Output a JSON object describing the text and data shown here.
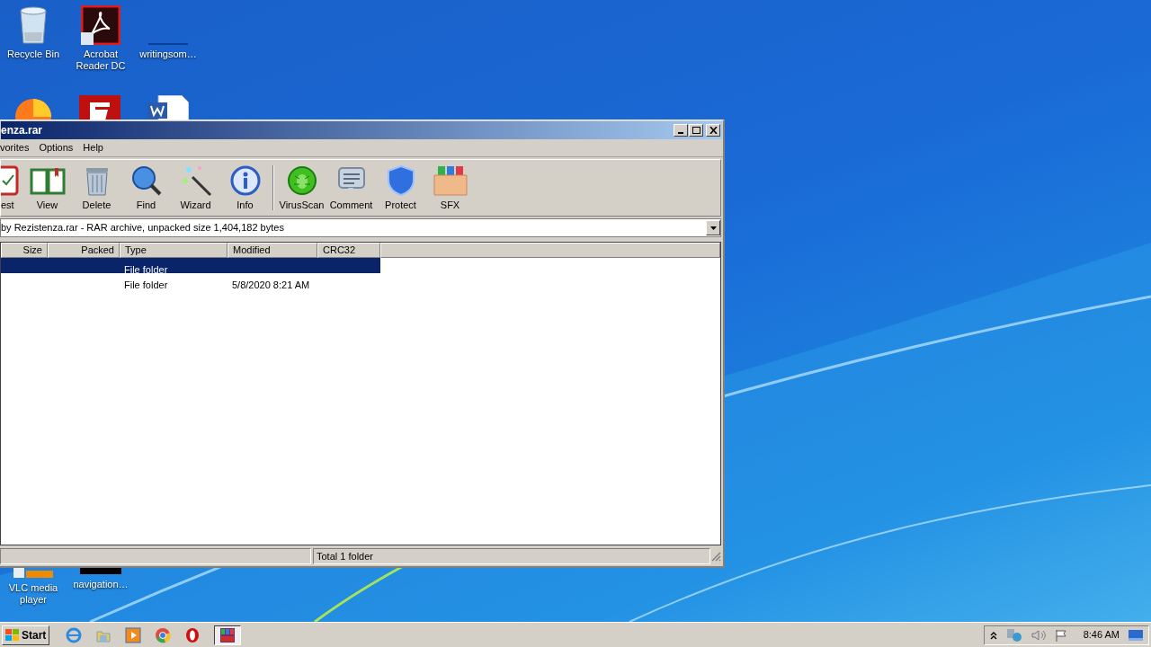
{
  "desktop_icons": [
    {
      "label": "Recycle Bin",
      "kind": "recycle"
    },
    {
      "label": "Acrobat Reader DC",
      "kind": "acrobat"
    },
    {
      "label": "writingsom…",
      "kind": "blank"
    }
  ],
  "bottom_icons": [
    {
      "label": "VLC media player",
      "kind": "vlc"
    },
    {
      "label": "navigation…",
      "kind": "dark"
    }
  ],
  "window": {
    "title": "enza.rar",
    "menu": [
      "vorites",
      "Options",
      "Help"
    ],
    "toolbar": [
      {
        "label": "est",
        "kind": "test"
      },
      {
        "label": "View",
        "kind": "view"
      },
      {
        "label": "Delete",
        "kind": "delete"
      },
      {
        "label": "Find",
        "kind": "find"
      },
      {
        "label": "Wizard",
        "kind": "wizard"
      },
      {
        "label": "Info",
        "kind": "info"
      },
      {
        "label": "VirusScan",
        "kind": "virus"
      },
      {
        "label": "Comment",
        "kind": "comment"
      },
      {
        "label": "Protect",
        "kind": "protect"
      },
      {
        "label": "SFX",
        "kind": "sfx"
      }
    ],
    "path": "by Rezistenza.rar - RAR archive, unpacked size 1,404,182 bytes",
    "columns": [
      "Size",
      "Packed",
      "Type",
      "Modified",
      "CRC32"
    ],
    "rows": [
      {
        "type": "File folder",
        "selected": true
      },
      {
        "type": "File folder",
        "modified": "5/8/2020 8:21 AM",
        "selected": false
      }
    ],
    "status": "Total 1 folder"
  },
  "taskbar": {
    "start": "Start",
    "apps": [
      {
        "kind": "ie",
        "active": false
      },
      {
        "kind": "explorer",
        "active": false
      },
      {
        "kind": "media",
        "active": false
      },
      {
        "kind": "chrome",
        "active": false
      },
      {
        "kind": "opera",
        "active": false
      },
      {
        "kind": "winrar",
        "active": true
      }
    ],
    "clock": "8:46 AM"
  }
}
